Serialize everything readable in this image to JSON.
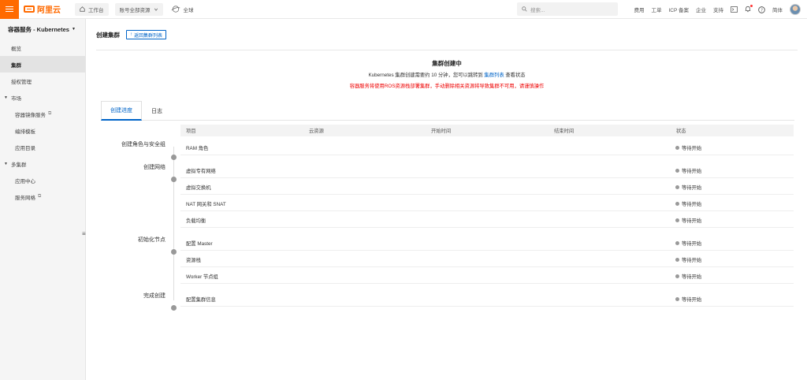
{
  "topbar": {
    "logo_text": "阿里云",
    "workbench": "工作台",
    "account_scope": "账号全部资源",
    "region": "全球",
    "search_placeholder": "搜索...",
    "links": [
      "费用",
      "工单",
      "ICP 备案",
      "企业",
      "支持"
    ],
    "language": "简体",
    "accent_color": "#ff6a00"
  },
  "sidebar": {
    "title": "容器服务 - Kubernetes",
    "items": [
      {
        "label": "概览",
        "type": "item"
      },
      {
        "label": "集群",
        "type": "item",
        "active": true
      },
      {
        "label": "授权管理",
        "type": "item"
      },
      {
        "label": "市场",
        "type": "group"
      },
      {
        "label": "容器镜像服务",
        "type": "sub",
        "external": true
      },
      {
        "label": "编排模板",
        "type": "sub"
      },
      {
        "label": "应用目录",
        "type": "sub"
      },
      {
        "label": "多集群",
        "type": "group"
      },
      {
        "label": "应用中心",
        "type": "sub"
      },
      {
        "label": "服务网格",
        "type": "sub",
        "external": true
      }
    ]
  },
  "main": {
    "page_title": "创建集群",
    "back_label": "返回集群列表",
    "status_title": "集群创建中",
    "status_desc_prefix": "Kubernetes 集群创建需要约 10 分钟，您可以跳转到",
    "status_desc_link": "集群列表",
    "status_desc_suffix": "查看状态",
    "status_warning": "容器服务将使用ROS资源栈部署集群，手动删除相关资源将导致集群不可用，请谨慎操作",
    "tabs": [
      {
        "label": "创建进度",
        "active": true
      },
      {
        "label": "日志",
        "active": false
      }
    ],
    "table_headers": [
      "项目",
      "云资源",
      "开始时间",
      "结束时间",
      "状态"
    ],
    "stages": [
      {
        "label": "创建角色与安全组",
        "rows": [
          {
            "item": "RAM 角色",
            "status": "等待开始"
          }
        ]
      },
      {
        "label": "创建网络",
        "rows": [
          {
            "item": "虚拟专有网络",
            "status": "等待开始"
          },
          {
            "item": "虚拟交换机",
            "status": "等待开始"
          },
          {
            "item": "NAT 网关和 SNAT",
            "status": "等待开始"
          },
          {
            "item": "负载均衡",
            "status": "等待开始"
          }
        ]
      },
      {
        "label": "初始化节点",
        "rows": [
          {
            "item": "配置 Master",
            "status": "等待开始"
          },
          {
            "item": "资源栈",
            "status": "等待开始"
          },
          {
            "item": "Worker 节点组",
            "status": "等待开始"
          }
        ]
      },
      {
        "label": "完成创建",
        "rows": [
          {
            "item": "配置集群信息",
            "status": "等待开始"
          }
        ]
      }
    ],
    "primary_color": "#0064c8",
    "warning_color": "#e00000"
  }
}
